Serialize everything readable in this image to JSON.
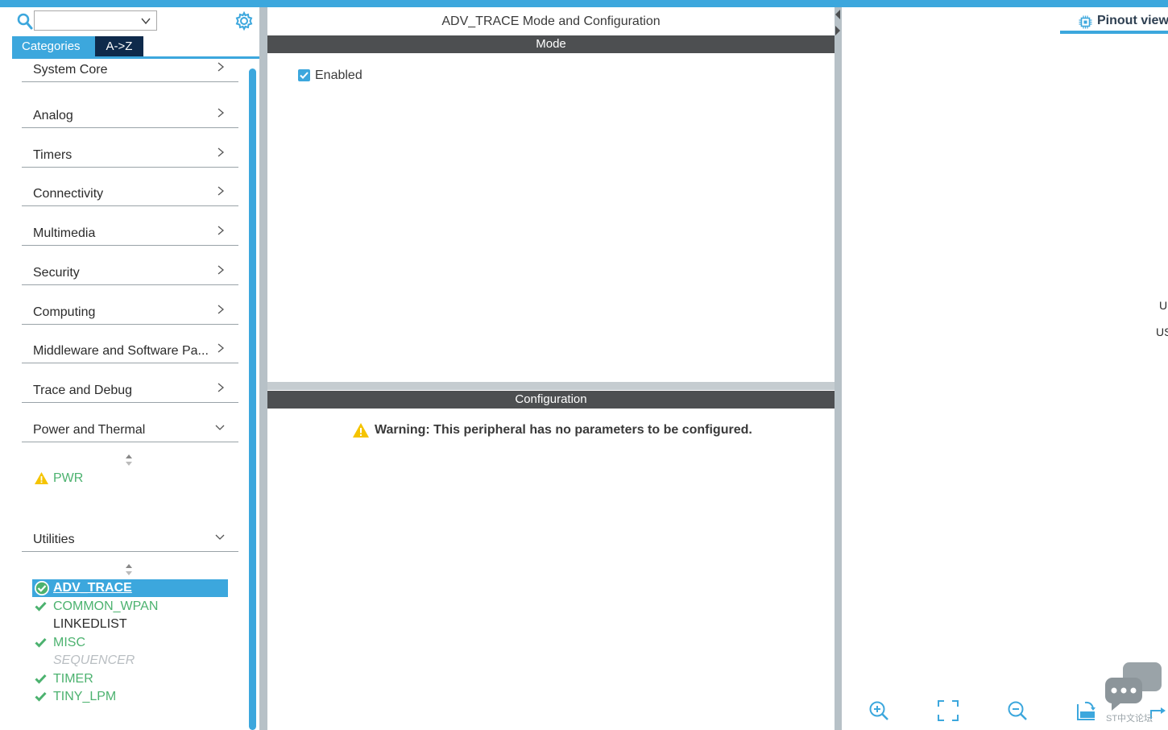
{
  "left_panel": {
    "search": {
      "placeholder": "",
      "value": ""
    },
    "tabs": [
      {
        "label": "Categories",
        "active": true
      },
      {
        "label": "A->Z",
        "active": false
      }
    ],
    "categories": [
      {
        "label": "System Core",
        "expanded": false
      },
      {
        "label": "Analog",
        "expanded": false
      },
      {
        "label": "Timers",
        "expanded": false
      },
      {
        "label": "Connectivity",
        "expanded": false
      },
      {
        "label": "Multimedia",
        "expanded": false
      },
      {
        "label": "Security",
        "expanded": false
      },
      {
        "label": "Computing",
        "expanded": false
      },
      {
        "label": "Middleware and Software Pa...",
        "expanded": false
      },
      {
        "label": "Trace and Debug",
        "expanded": false
      },
      {
        "label": "Power and Thermal",
        "expanded": true
      },
      {
        "label": "Utilities",
        "expanded": true
      }
    ],
    "power_items": [
      {
        "label": "PWR",
        "status": "warning"
      }
    ],
    "utilities_items": [
      {
        "label": "ADV_TRACE",
        "status": "ok",
        "selected": true
      },
      {
        "label": "COMMON_WPAN",
        "status": "ok"
      },
      {
        "label": "LINKEDLIST",
        "status": "none"
      },
      {
        "label": "MISC",
        "status": "ok"
      },
      {
        "label": "SEQUENCER",
        "status": "disabled"
      },
      {
        "label": "TIMER",
        "status": "ok"
      },
      {
        "label": "TINY_LPM",
        "status": "ok"
      }
    ]
  },
  "center_panel": {
    "title": "ADV_TRACE Mode and Configuration",
    "mode_header": "Mode",
    "enabled_label": "Enabled",
    "enabled_checked": true,
    "config_header": "Configuration",
    "warning_text": "Warning: This peripheral has no parameters to be configured."
  },
  "right_panel": {
    "tab_label": "Pinout view",
    "edge_text_1": "U",
    "edge_text_2": "US",
    "forum_text": "ST中文论坛",
    "tools": [
      "zoom-in-icon",
      "fit-screen-icon",
      "zoom-out-icon",
      "rotate-icon",
      "flip-icon"
    ]
  },
  "colors": {
    "accent": "#3ca7dd",
    "dark_tab": "#0e2a4b",
    "section_bar": "#4d4f51",
    "ok_green": "#4cb26f",
    "warning_yellow": "#f5c400"
  }
}
